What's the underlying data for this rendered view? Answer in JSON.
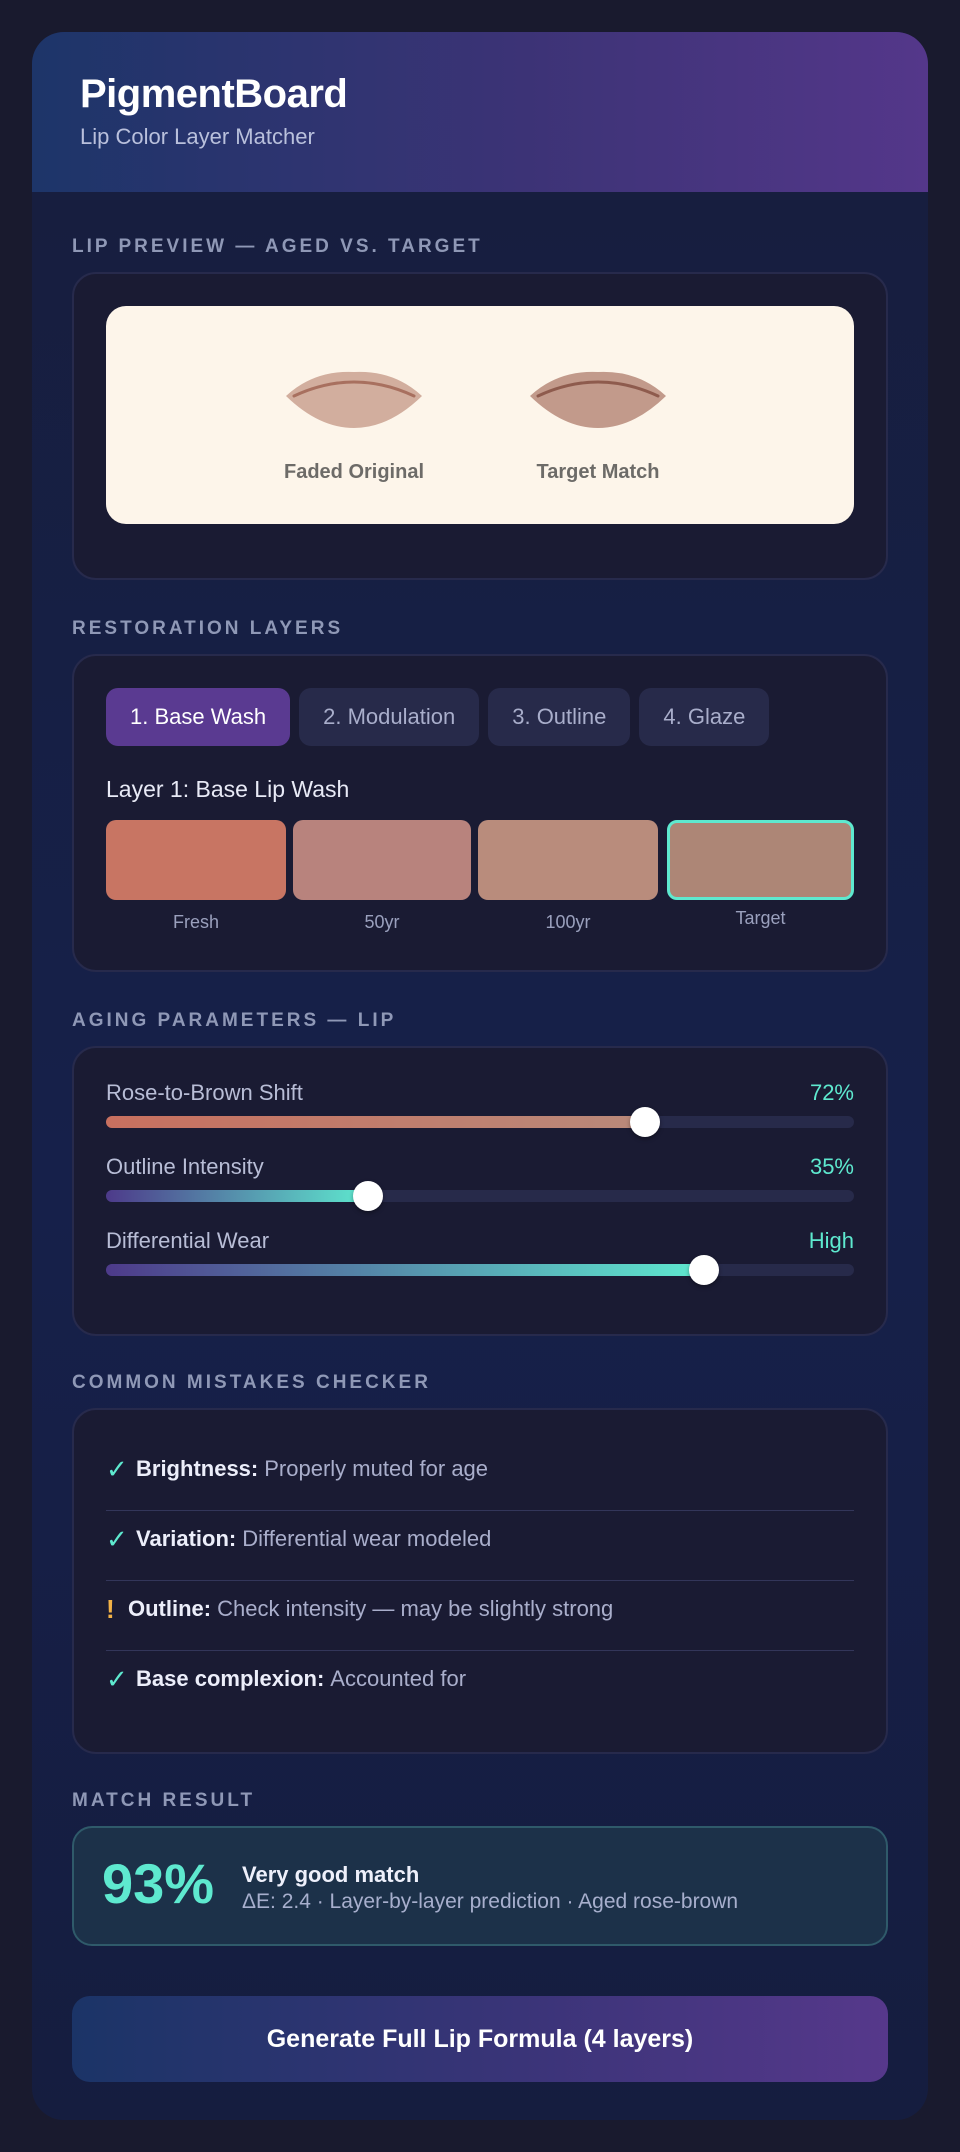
{
  "header": {
    "title": "PigmentBoard",
    "subtitle": "Lip Color Layer Matcher"
  },
  "preview": {
    "section_label": "LIP PREVIEW — AGED VS. TARGET",
    "items": [
      {
        "label": "Faded Original",
        "color": "#d2ae9e",
        "line_color": "#a8705f"
      },
      {
        "label": "Target Match",
        "color": "#c29a8b",
        "line_color": "#8e5b4d"
      }
    ]
  },
  "layers": {
    "section_label": "RESTORATION LAYERS",
    "tabs": [
      {
        "label": "1. Base Wash",
        "active": true
      },
      {
        "label": "2. Modulation",
        "active": false
      },
      {
        "label": "3. Outline",
        "active": false
      },
      {
        "label": "4. Glaze",
        "active": false
      }
    ],
    "layer_title": "Layer 1: Base Lip Wash",
    "swatches": [
      {
        "label": "Fresh",
        "color": "#c87563"
      },
      {
        "label": "50yr",
        "color": "#b8837d"
      },
      {
        "label": "100yr",
        "color": "#b98c7c"
      },
      {
        "label": "Target",
        "color": "#ad8676",
        "selected": true
      }
    ]
  },
  "aging": {
    "section_label": "AGING PARAMETERS — LIP",
    "sliders": [
      {
        "label": "Rose-to-Brown Shift",
        "value_text": "72%",
        "level": 0.72,
        "fill_from": "#c8705f",
        "fill_to": "#b9897a"
      },
      {
        "label": "Outline Intensity",
        "value_text": "35%",
        "level": 0.35,
        "fill_from": "#4d3a8a",
        "fill_to": "#5ee9cf"
      },
      {
        "label": "Differential Wear",
        "value_text": "High",
        "level": 0.8,
        "fill_from": "#4d3a8a",
        "fill_to": "#5ee9cf"
      }
    ]
  },
  "checker": {
    "section_label": "COMMON MISTAKES CHECKER",
    "items": [
      {
        "status": "ok",
        "icon": "✓",
        "name": "Brightness:",
        "text": "Properly muted for age"
      },
      {
        "status": "ok",
        "icon": "✓",
        "name": "Variation:",
        "text": "Differential wear modeled"
      },
      {
        "status": "warn",
        "icon": "!",
        "name": "Outline:",
        "text": "Check intensity — may be slightly strong"
      },
      {
        "status": "ok",
        "icon": "✓",
        "name": "Base complexion:",
        "text": "Accounted for"
      }
    ]
  },
  "result": {
    "section_label": "MATCH RESULT",
    "percent": "93%",
    "title": "Very good match",
    "detail": "ΔE: 2.4 · Layer-by-layer prediction · Aged rose-brown"
  },
  "cta": {
    "label": "Generate Full Lip Formula (4 layers)"
  }
}
